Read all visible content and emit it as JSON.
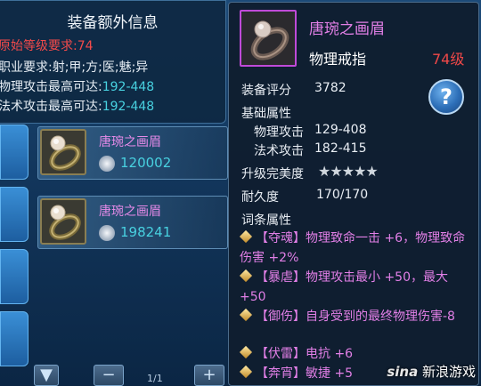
{
  "extra_info": {
    "title": "装备额外信息",
    "req_level_label": "原始等级要求:74",
    "class_label": "职业要求:射;甲;方;医;魅;异",
    "phys_label": "物理攻击最高可达:",
    "phys_value": "192-448",
    "magic_label": "法术攻击最高可达:",
    "magic_value": "192-448"
  },
  "item_list": [
    {
      "name": "唐琬之画眉",
      "price": "120002"
    },
    {
      "name": "唐琬之画眉",
      "price": "198241"
    }
  ],
  "pager": "1/1",
  "tooltip": {
    "name": "唐琬之画眉",
    "type": "物理戒指",
    "level": "74级",
    "score_label": "装备评分",
    "score_value": "3782",
    "base_attr_label": "基础属性",
    "phys_atk_label": "物理攻击",
    "phys_atk_value": "129-408",
    "magic_atk_label": "法术攻击",
    "magic_atk_value": "182-415",
    "upgrade_label": "升级完美度",
    "durability_label": "耐久度",
    "durability_value": "170/170",
    "affix_label": "词条属性",
    "affixes": [
      {
        "tag": "【夺魂】",
        "desc": "物理致命一击 +6，物理致命伤害 +2%"
      },
      {
        "tag": "【暴虐】",
        "desc": "物理攻击最小 +50，最大 +50"
      },
      {
        "tag": "【御伤】",
        "desc": "自身受到的最终物理伤害-8"
      },
      {
        "tag": "【伏雷】",
        "desc": "电抗 +6"
      },
      {
        "tag": "【奔宵】",
        "desc": "敏捷 +5"
      }
    ],
    "help": "?"
  },
  "watermark": {
    "logo": "sina",
    "text": "新浪游戏"
  }
}
